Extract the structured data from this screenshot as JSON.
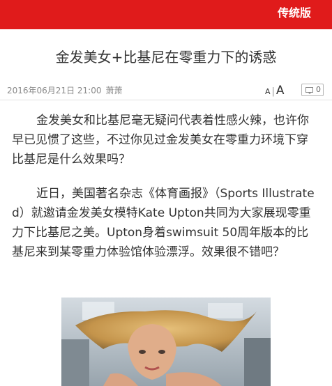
{
  "header": {
    "switch_label": "传统版"
  },
  "article": {
    "title": "金发美女+比基尼在零重力下的诱惑",
    "date": "2016年06月21日 21:00",
    "author": "萧萧",
    "font_small": "A",
    "font_sep": "|",
    "font_large": "A",
    "comment_count": "0",
    "paragraphs": [
      "金发美女和比基尼毫无疑问代表着性感火辣，也许你早已见惯了这些，不过你见过金发美女在零重力环境下穿比基尼是什么效果吗？",
      "近日，美国著名杂志《体育画报》（Sports Illustrated）就邀请金发美女模特Kate Upton共同为大家展现零重力下比基尼之美。Upton身着swimsuit 50周年版本的比基尼来到某零重力体验馆体验漂浮。效果很不错吧？"
    ]
  },
  "colors": {
    "brand_red": "#e01b1b",
    "text": "#333333",
    "meta": "#8a8a8a"
  }
}
